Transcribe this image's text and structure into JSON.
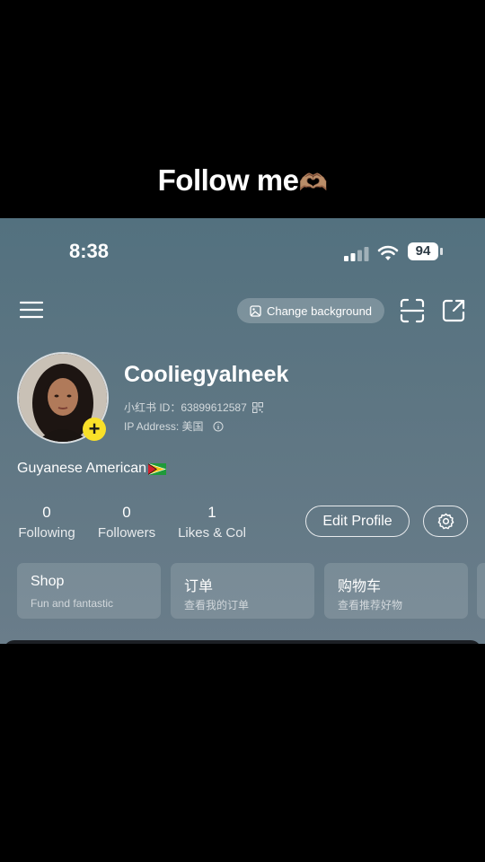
{
  "caption": {
    "text": "Follow me",
    "emoji": "🫶🏽"
  },
  "status_bar": {
    "time": "8:38",
    "battery": "94"
  },
  "toolbar": {
    "change_background_label": "Change background"
  },
  "profile": {
    "username": "Cooliegyalneek",
    "id_label": "小红书 ID：",
    "id_value": "63899612587",
    "ip_label": "IP Address:",
    "ip_value": "美国",
    "bio": "Guyanese American",
    "bio_flag": "🇬🇾"
  },
  "stats": [
    {
      "value": "0",
      "label": "Following"
    },
    {
      "value": "0",
      "label": "Followers"
    },
    {
      "value": "1",
      "label": "Likes & Col"
    }
  ],
  "actions": {
    "edit_profile_label": "Edit Profile"
  },
  "cards": [
    {
      "title": "Shop",
      "subtitle": "Fun and fantastic"
    },
    {
      "title": "订单",
      "subtitle": "查看我的订单"
    },
    {
      "title": "购物车",
      "subtitle": "查看推荐好物"
    }
  ],
  "icons": [
    "menu-icon",
    "image-icon",
    "scan-icon",
    "share-icon",
    "qr-code-icon",
    "info-icon",
    "gear-icon",
    "plus-icon",
    "wifi-icon",
    "signal-icon"
  ]
}
